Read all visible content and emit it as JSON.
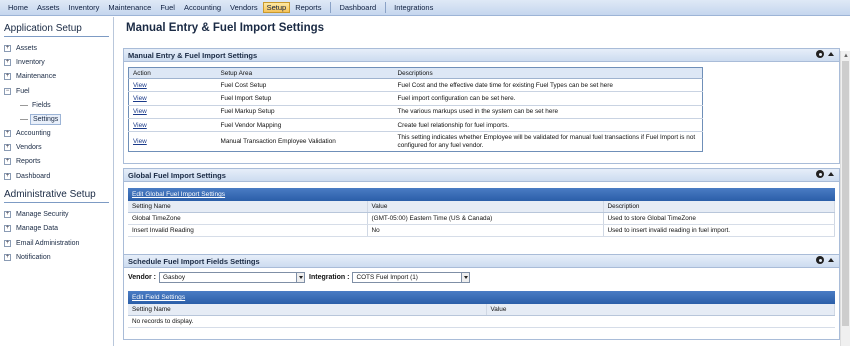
{
  "menu": [
    "Home",
    "Assets",
    "Inventory",
    "Maintenance",
    "Fuel",
    "Accounting",
    "Vendors",
    "Setup",
    "Reports",
    "Dashboard",
    "Integrations"
  ],
  "menu_active": "Setup",
  "sidebar": {
    "app_setup_title": "Application Setup",
    "admin_setup_title": "Administrative Setup",
    "items": {
      "assets": "Assets",
      "inventory": "Inventory",
      "maintenance": "Maintenance",
      "fuel": "Fuel",
      "fields": "Fields",
      "settings": "Settings",
      "accounting": "Accounting",
      "vendors": "Vendors",
      "reports": "Reports",
      "dashboard": "Dashboard"
    },
    "admin": {
      "security": "Manage Security",
      "data": "Manage Data",
      "email": "Email Administration",
      "notification": "Notification"
    },
    "expand_symbol": "+",
    "collapse_symbol": "−"
  },
  "page_title": "Manual Entry & Fuel Import Settings",
  "panel1": {
    "title": "Manual Entry & Fuel Import Settings",
    "headers": [
      "Action",
      "Setup Area",
      "Descriptions"
    ],
    "rows": [
      {
        "action": "View",
        "area": "Fuel Cost Setup",
        "desc": "Fuel Cost and the effective date time for existing Fuel Types can be set here"
      },
      {
        "action": "View",
        "area": "Fuel Import Setup",
        "desc": "Fuel import configuration can be set here."
      },
      {
        "action": "View",
        "area": "Fuel Markup Setup",
        "desc": "The various markups used in the system can be set here"
      },
      {
        "action": "View",
        "area": "Fuel Vendor Mapping",
        "desc": "Create fuel relationship for fuel imports."
      },
      {
        "action": "View",
        "area": "Manual Transaction Employee Validation",
        "desc": "This setting indicates whether Employee will be validated for manual fuel transactions if Fuel Import is not configured for any fuel vendor."
      }
    ]
  },
  "panel2": {
    "title": "Global Fuel Import Settings",
    "edit_link": "Edit Global Fuel Import Settings",
    "headers": [
      "Setting Name",
      "Value",
      "Description"
    ],
    "rows": [
      {
        "name": "Global TimeZone",
        "value": "(GMT-05:00) Eastern Time (US & Canada)",
        "desc": "Used to store Global TimeZone"
      },
      {
        "name": "Insert Invalid Reading",
        "value": "No",
        "desc": "Used to insert invalid reading in fuel import."
      }
    ]
  },
  "panel3": {
    "title": "Schedule Fuel Import Fields Settings",
    "vendor_label": "Vendor :",
    "vendor_value": "Gasboy",
    "integration_label": "Integration :",
    "integration_value": "COTS Fuel Import (1)",
    "edit_link": "Edit Field Settings",
    "headers": [
      "Setting Name",
      "Value"
    ],
    "empty": "No records to display."
  }
}
